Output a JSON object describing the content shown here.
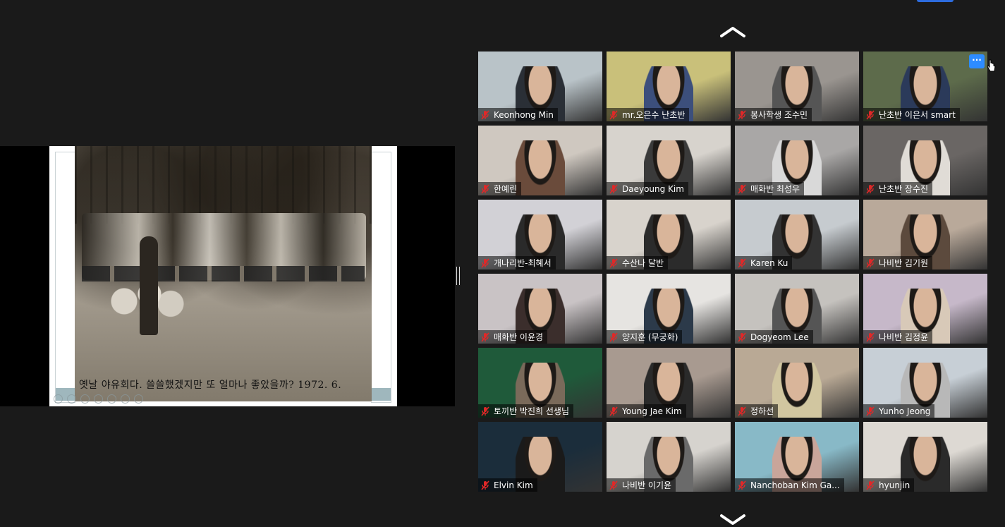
{
  "shared_screen": {
    "caption": "옛날 야유회다. 쓸쓸했겠지만 또 얼마나 좋았을까? 1972. 6."
  },
  "gallery": {
    "participants": [
      {
        "name": "Keonhong Min",
        "scene": "#b9c3c8",
        "shirt": "#2a2f36"
      },
      {
        "name": "mr.오은수 난초반",
        "scene": "#c9c07a",
        "shirt": "#3c4f7c"
      },
      {
        "name": "봉사학생 조수민",
        "scene": "#9a9590",
        "shirt": "#555"
      },
      {
        "name": "난초반 이은서 smart",
        "scene": "#5d6b4b",
        "shirt": "#2b3a5a"
      },
      {
        "name": "한예린",
        "scene": "#cfc8c0",
        "shirt": "#6a4b3b"
      },
      {
        "name": "Daeyoung Kim",
        "scene": "#d7d3cd",
        "shirt": "#3a3a3a"
      },
      {
        "name": "매화반 최성우",
        "scene": "#a9a7a6",
        "shirt": "#d9d9d9"
      },
      {
        "name": "난초반 장수진",
        "scene": "#6a6664",
        "shirt": "#e0dcd6"
      },
      {
        "name": "개나리반-최혜서",
        "scene": "#d2d1d6",
        "shirt": "#2a2a2a"
      },
      {
        "name": "수산나 달반",
        "scene": "#d8d3cc",
        "shirt": "#2b2b2b"
      },
      {
        "name": "Karen Ku",
        "scene": "#c6cbcf",
        "shirt": "#333"
      },
      {
        "name": "나비반 김기원",
        "scene": "#b9a99a",
        "shirt": "#5c4a3d"
      },
      {
        "name": "매화반 이윤경",
        "scene": "#c9c3c5",
        "shirt": "#3b2e2c"
      },
      {
        "name": "양지훈 (무궁화)",
        "scene": "#e6e4e1",
        "shirt": "#2c3a4a"
      },
      {
        "name": "Dogyeom Lee",
        "scene": "#c5c2be",
        "shirt": "#555"
      },
      {
        "name": "나비반 김정윤",
        "scene": "#c6b8c9",
        "shirt": "#d8c9b8"
      },
      {
        "name": "토끼반 박진희 선생님",
        "scene": "#1f5a3a",
        "shirt": "#7a6a5a"
      },
      {
        "name": "Young Jae Kim",
        "scene": "#a89a90",
        "shirt": "#2a2a2a"
      },
      {
        "name": "정하선",
        "scene": "#b9a995",
        "shirt": "#d1c6a0"
      },
      {
        "name": "Yunho Jeong",
        "scene": "#c7cfd6",
        "shirt": "#b8b8b8"
      },
      {
        "name": "Elvin Kim",
        "scene": "#1b2d3b",
        "shirt": "#1a1a1a"
      },
      {
        "name": "나비반 이기윤",
        "scene": "#d6d3ce",
        "shirt": "#6a6a6a"
      },
      {
        "name": "Nanchoban Kim Ga...",
        "scene": "#88b9c7",
        "shirt": "#c9a59a"
      },
      {
        "name": "hyunjin",
        "scene": "#ddd9d3",
        "shirt": "#2a2a2a"
      }
    ],
    "more_button_label": "···"
  },
  "icons": {
    "mute": "microphone-muted-icon",
    "up": "chevron-up-icon",
    "down": "chevron-down-icon"
  },
  "colors": {
    "accent": "#2d8cff",
    "mute_red": "#e02828"
  }
}
